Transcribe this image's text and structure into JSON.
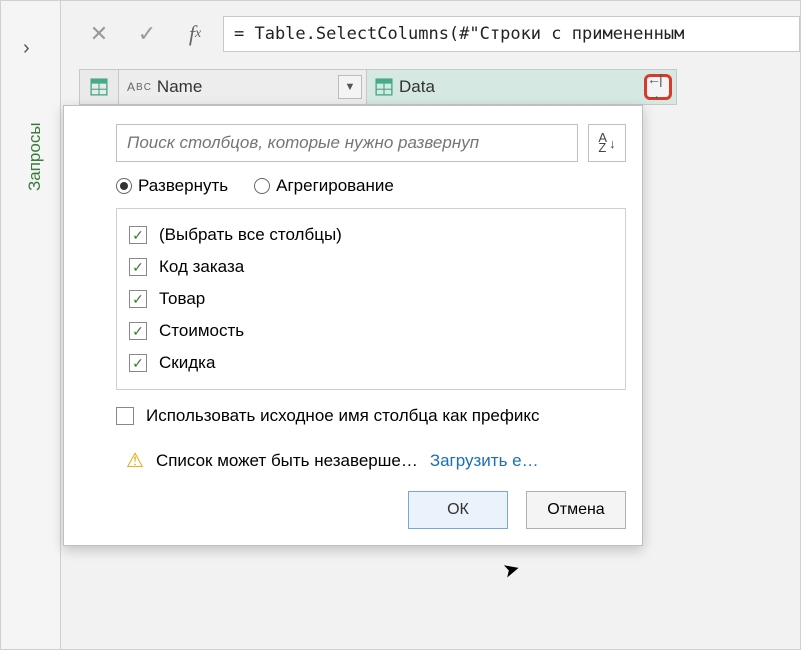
{
  "sidebar": {
    "label": "Запросы"
  },
  "formula": {
    "text": "= Table.SelectColumns(#\"Строки с примененным"
  },
  "columns": {
    "name_label": "Name",
    "data_label": "Data"
  },
  "popup": {
    "search_placeholder": "Поиск столбцов, которые нужно развернуп",
    "radio_expand": "Развернуть",
    "radio_aggregate": "Агрегирование",
    "items": [
      "(Выбрать все столбцы)",
      "Код заказа",
      "Товар",
      "Стоимость",
      "Скидка"
    ],
    "prefix_label": "Использовать исходное имя столбца как префикс",
    "warning_text": "Список может быть незаверше…",
    "load_link": "Загрузить е…",
    "ok_label": "ОК",
    "cancel_label": "Отмена"
  }
}
